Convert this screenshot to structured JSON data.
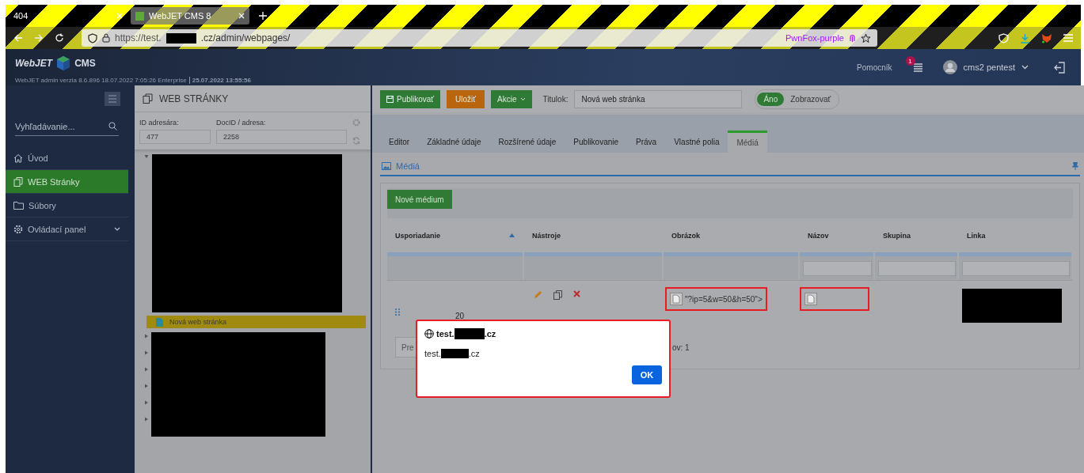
{
  "browser": {
    "tabs": [
      {
        "title": "404",
        "selected": false
      },
      {
        "title": "WebJET CMS 8",
        "selected": true
      }
    ],
    "url": {
      "before_redaction": "https://test.",
      "after_redaction": ".cz/admin/webpages/"
    },
    "container": "PwnFox-purple"
  },
  "header": {
    "logo_left": "WebJET",
    "logo_right": "CMS",
    "version": "WebJET admin verzia 8.6.896 18.07.2022 7:05:26 Enterprise",
    "timestamp": "25.07.2022 13:55:56",
    "help": "Pomocník",
    "notifications": "1",
    "user": "cms2 pentest"
  },
  "sidebar": {
    "search": {
      "placeholder": "Vyhľadávanie..."
    },
    "items": [
      {
        "label": "Úvod",
        "kind": "home",
        "selected": false,
        "submenu": false
      },
      {
        "label": "WEB Stránky",
        "kind": "pages",
        "selected": true,
        "submenu": false
      },
      {
        "label": "Súbory",
        "kind": "folder",
        "selected": false,
        "submenu": false
      },
      {
        "label": "Ovládací panel",
        "kind": "settings",
        "selected": false,
        "submenu": true
      }
    ]
  },
  "tree_panel": {
    "title": "WEB STRÁNKY",
    "folder_id": {
      "label": "ID adresára:",
      "value": "477"
    },
    "doc_id": {
      "label": "DocID / adresa:",
      "value": "2258"
    },
    "nodes": [
      {
        "expanded": true,
        "children": [
          {
            "label": "Nová web stránka",
            "selected": true
          }
        ]
      },
      {
        "expanded": false
      },
      {
        "expanded": false
      },
      {
        "expanded": false
      },
      {
        "expanded": false
      },
      {
        "expanded": false
      },
      {
        "expanded": false
      }
    ]
  },
  "editor": {
    "buttons": [
      {
        "label": "Publikovať",
        "kind": "publish"
      },
      {
        "label": "Uložiť",
        "kind": "save"
      },
      {
        "label": "Akcie",
        "kind": "menu"
      }
    ],
    "title_field": {
      "label": "Titulok:",
      "value": "Nová web stránka"
    },
    "visibility": {
      "on": true,
      "on_label": "Áno",
      "label": "Zobrazovať"
    },
    "tabs": [
      {
        "label": "Editor",
        "selected": false
      },
      {
        "label": "Základné údaje",
        "selected": false
      },
      {
        "label": "Rozšírené údaje",
        "selected": false
      },
      {
        "label": "Publikovanie",
        "selected": false
      },
      {
        "label": "Práva",
        "selected": false
      },
      {
        "label": "Vlastné polia",
        "selected": false
      },
      {
        "label": "Médiá",
        "selected": true
      }
    ],
    "section": "Médiá",
    "media": {
      "new_button": "Nové médium",
      "columns": [
        {
          "label": "Usporiadanie",
          "sorted": true,
          "filter": false
        },
        {
          "label": "Nástroje",
          "sorted": false,
          "filter": false
        },
        {
          "label": "Obrázok",
          "sorted": false,
          "filter": false
        },
        {
          "label": "Názov",
          "sorted": false,
          "filter": true
        },
        {
          "label": "Skupina",
          "sorted": false,
          "filter": true
        },
        {
          "label": "Linka",
          "sorted": false,
          "filter": true
        }
      ],
      "rows": [
        {
          "order": "20",
          "image_text": "\"?ip=5&w=50&h=50\">",
          "image_highlighted": true,
          "name_highlighted": true,
          "link_redacted": true
        }
      ],
      "pagination": {
        "button": "Pre",
        "info": "ov: 1"
      }
    }
  },
  "dialog": {
    "title_before": "test.",
    "title_after": ".cz",
    "message_before": "test.",
    "message_after": ".cz",
    "button": "OK",
    "highlighted": true
  }
}
